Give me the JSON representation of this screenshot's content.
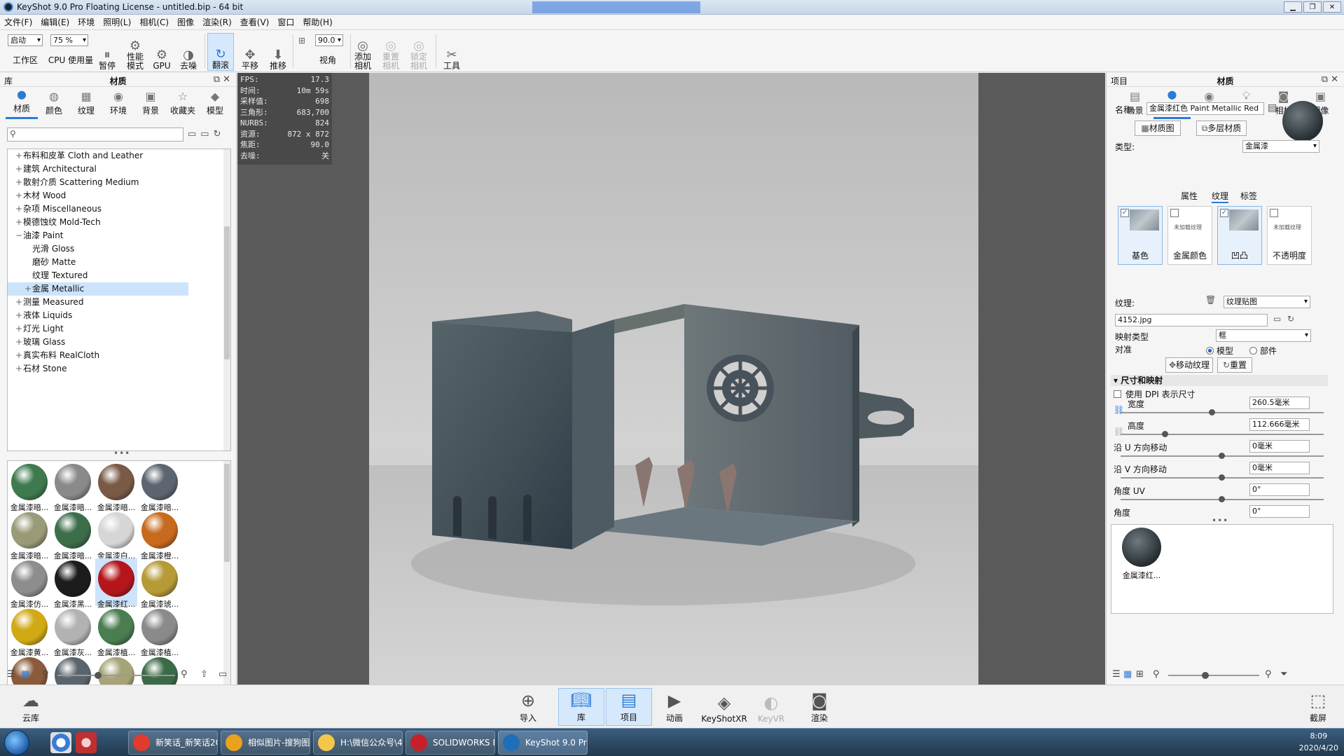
{
  "window": {
    "title": "KeyShot 9.0 Pro Floating License  - untitled.bip  - 64 bit"
  },
  "menu": [
    "文件(F)",
    "编辑(E)",
    "环境",
    "照明(L)",
    "相机(C)",
    "图像",
    "渲染(R)",
    "查看(V)",
    "窗口",
    "帮助(H)"
  ],
  "toolbar": {
    "mode_value": "启动",
    "workspace_label": "工作区",
    "zoom_value": "75 %",
    "cpu_label": "CPU 使用量",
    "pause_label": "暂停",
    "perf_label": "性能\n模式",
    "gpu_label": "GPU",
    "denoise_label": "去噪",
    "tumble_label": "翻滚",
    "pan_label": "平移",
    "dolly_label": "推移",
    "fov_value": "90.0",
    "fov_label": "视角",
    "add_camera_label": "添加\n相机",
    "reset_camera_label": "重置\n相机",
    "lock_camera_label": "锁定\n相机",
    "tools_label": "工具"
  },
  "library": {
    "header_left": "库",
    "header_title": "材质",
    "tabs": [
      "材质",
      "颜色",
      "纹理",
      "环境",
      "背景",
      "收藏夹",
      "模型"
    ],
    "tree": [
      {
        "label": "布料和皮革 Cloth and Leather",
        "level": 0,
        "pm": "+"
      },
      {
        "label": "建筑 Architectural",
        "level": 0,
        "pm": "+"
      },
      {
        "label": "散射介质 Scattering Medium",
        "level": 0,
        "pm": "+"
      },
      {
        "label": "木材 Wood",
        "level": 0,
        "pm": "+"
      },
      {
        "label": "杂项 Miscellaneous",
        "level": 0,
        "pm": "+"
      },
      {
        "label": "模德蚀纹 Mold-Tech",
        "level": 0,
        "pm": "+"
      },
      {
        "label": "油漆 Paint",
        "level": 0,
        "pm": "−"
      },
      {
        "label": "光滑 Gloss",
        "level": 1,
        "pm": ""
      },
      {
        "label": "磨砂 Matte",
        "level": 1,
        "pm": ""
      },
      {
        "label": "纹理 Textured",
        "level": 1,
        "pm": ""
      },
      {
        "label": "金属 Metallic",
        "level": 1,
        "pm": "+",
        "selected": true
      },
      {
        "label": "测量 Measured",
        "level": 0,
        "pm": "+"
      },
      {
        "label": "液体 Liquids",
        "level": 0,
        "pm": "+"
      },
      {
        "label": "灯光 Light",
        "level": 0,
        "pm": "+"
      },
      {
        "label": "玻璃 Glass",
        "level": 0,
        "pm": "+"
      },
      {
        "label": "真实布料 RealCloth",
        "level": 0,
        "pm": "+"
      },
      {
        "label": "石材 Stone",
        "level": 0,
        "pm": "+"
      }
    ],
    "swatches": [
      {
        "label": "金属漆暗...",
        "color": "#3f7a4e"
      },
      {
        "label": "金属漆暗...",
        "color": "#8a8a8a"
      },
      {
        "label": "金属漆暗...",
        "color": "#7a5a46"
      },
      {
        "label": "金属漆暗...",
        "color": "#5d6670"
      },
      {
        "label": "金属漆暗...",
        "color": "#9a9a78"
      },
      {
        "label": "金属漆暗...",
        "color": "#3c6e4a"
      },
      {
        "label": "金属漆白...",
        "color": "#d6d6d6"
      },
      {
        "label": "金属漆橙...",
        "color": "#c86a1e"
      },
      {
        "label": "金属漆仿...",
        "color": "#8d8d8d"
      },
      {
        "label": "金属漆黑...",
        "color": "#1c1c1c"
      },
      {
        "label": "金属漆红...",
        "color": "#b5161b",
        "selected": true
      },
      {
        "label": "金属漆琥...",
        "color": "#b59a36"
      },
      {
        "label": "金属漆黄...",
        "color": "#d0a915"
      },
      {
        "label": "金属漆灰...",
        "color": "#b2b2b2"
      },
      {
        "label": "金属漆植...",
        "color": "#4a7d4f"
      },
      {
        "label": "金属漆植...",
        "color": "#8a8a8a"
      },
      {
        "label": "",
        "color": "#8a5a3a"
      },
      {
        "label": "",
        "color": "#59646c"
      },
      {
        "label": "",
        "color": "#a5a377"
      },
      {
        "label": "",
        "color": "#3a6a46"
      }
    ]
  },
  "hud": [
    {
      "k": "FPS:",
      "v": "17.3"
    },
    {
      "k": "时间:",
      "v": "10m 59s"
    },
    {
      "k": "采样值:",
      "v": "698"
    },
    {
      "k": "三角形:",
      "v": "683,700"
    },
    {
      "k": "NURBS:",
      "v": "824"
    },
    {
      "k": "资源:",
      "v": "872 x 872"
    },
    {
      "k": "焦距:",
      "v": "90.0"
    },
    {
      "k": "去噪:",
      "v": "关"
    }
  ],
  "project": {
    "header_left": "项目",
    "header_title": "材质",
    "tabs": [
      "场景",
      "材质",
      "环境",
      "照明",
      "相机",
      "图像"
    ],
    "name_label": "名称:",
    "name_value": "金属漆红色 Paint Metallic Red",
    "material_graph_button": "材质图",
    "multi_layer_button": "多层材质",
    "type_label": "类型:",
    "type_value": "金属漆",
    "subtabs": [
      "属性",
      "纹理",
      "标签"
    ],
    "texture_slots": [
      {
        "name": "基色",
        "checked": true,
        "has_texture": true
      },
      {
        "name": "金属颜色",
        "checked": false,
        "has_texture": false
      },
      {
        "name": "凹凸",
        "checked": true,
        "has_texture": true
      },
      {
        "name": "不透明度",
        "checked": false,
        "has_texture": false
      }
    ],
    "no_texture_text": "未加载纹理",
    "texture_label": "纹理:",
    "texture_type": "纹理贴图",
    "texture_file": "4152.jpg",
    "mapping_label": "映射类型",
    "mapping_value": "框",
    "align_label": "对准",
    "align_model": "模型",
    "align_part": "部件",
    "move_texture_button": "移动纹理",
    "reset_button": "重置",
    "section_title": "尺寸和映射",
    "dpi_label": "使用 DPI 表示尺寸",
    "width_label": "宽度",
    "width_value": "260.5毫米",
    "height_label": "高度",
    "height_value": "112.666毫米",
    "u_label": "沿 U 方向移动",
    "u_value": "0毫米",
    "v_label": "沿 V 方向移动",
    "v_value": "0毫米",
    "uv_angle_label": "角度 UV",
    "uv_angle_value": "0°",
    "angle_label": "角度",
    "angle_value": "0°",
    "scene_material_label": "金属漆红..."
  },
  "bottom": {
    "cloud_label": "云库",
    "import_label": "导入",
    "library_label": "库",
    "project_label": "项目",
    "animation_label": "动画",
    "keyshotxr_label": "KeyShotXR",
    "keyvr_label": "KeyVR",
    "render_label": "渲染",
    "screenshot_label": "截屏"
  },
  "taskbar": {
    "tasks": [
      "新笑话_新笑话20...",
      "相似图片-搜狗图...",
      "H:\\微信公众号\\4-...",
      "SOLIDWORKS P...",
      "KeyShot 9.0 Pro..."
    ],
    "time": "8:09",
    "date": "2020/4/20"
  }
}
